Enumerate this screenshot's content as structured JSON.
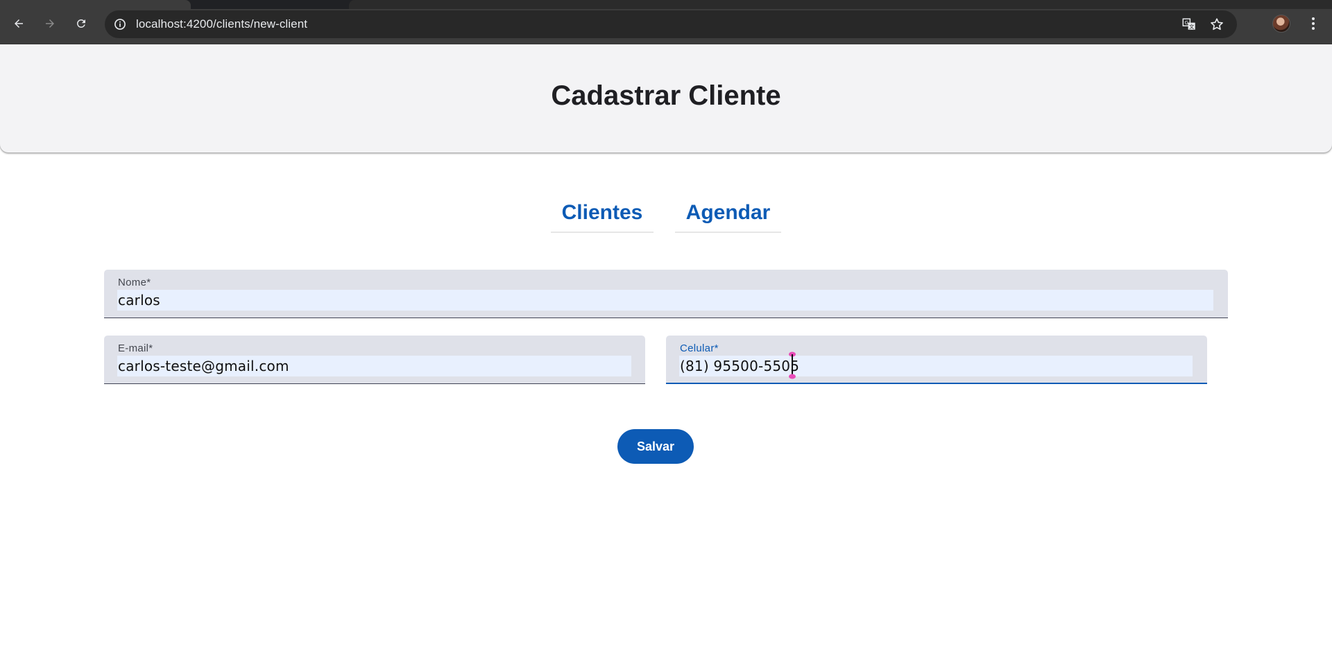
{
  "browser": {
    "url": "localhost:4200/clients/new-client",
    "back_icon": "arrow-left-icon",
    "forward_icon": "arrow-right-icon",
    "reload_icon": "reload-icon",
    "site_info_icon": "info-icon",
    "translate_icon": "translate-icon",
    "bookmark_icon": "star-icon",
    "menu_icon": "kebab-menu-icon"
  },
  "header": {
    "title": "Cadastrar Cliente"
  },
  "nav": {
    "items": [
      {
        "label": "Clientes"
      },
      {
        "label": "Agendar"
      }
    ]
  },
  "form": {
    "nome": {
      "label": "Nome*",
      "value": "carlos"
    },
    "email": {
      "label": "E-mail*",
      "value": "carlos-teste@gmail.com"
    },
    "celular": {
      "label": "Celular*",
      "value": "(81) 95500-5505",
      "focused": true
    },
    "save_label": "Salvar"
  },
  "colors": {
    "primary": "#0d5bb5",
    "header_bg": "#f3f3f5",
    "field_bg": "#dfe1e9",
    "autofill_bg": "#e8f0fe",
    "chrome_bg": "#3c3c3c"
  }
}
